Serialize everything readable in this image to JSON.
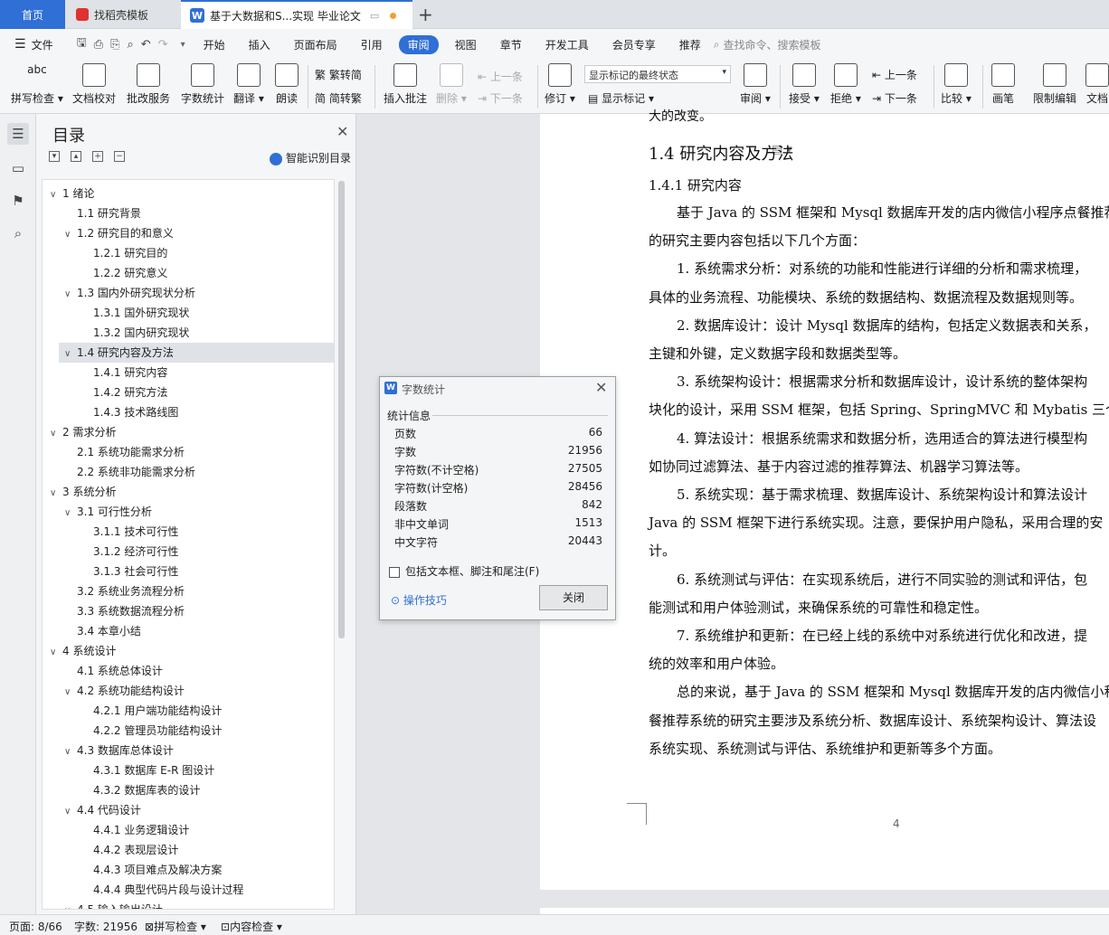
{
  "tabs": {
    "home": "首页",
    "template": "找稻壳模板",
    "document": "基于大数据和S...实现 毕业论文",
    "add": "+"
  },
  "menu": {
    "file": "文件",
    "items": [
      "开始",
      "插入",
      "页面布局",
      "引用",
      "审阅",
      "视图",
      "章节",
      "开发工具",
      "会员专享",
      "推荐"
    ],
    "search": "查找命令、搜索模板"
  },
  "ribbon": {
    "spellcheck": "拼写检查",
    "doc_check": "文档校对",
    "batch_service": "批改服务",
    "word_count": "字数统计",
    "translate": "翻译",
    "read_aloud": "朗读",
    "trad_to_simp": "繁转简",
    "simp_to_trad": "简转繁",
    "insert_comment": "插入批注",
    "delete": "删除",
    "prev": "上一条",
    "next": "下一条",
    "track_changes": "修订",
    "markup_state": "显示标记的最终状态",
    "show_markup": "显示标记",
    "review": "审阅",
    "accept": "接受",
    "reject": "拒绝",
    "prev2": "上一条",
    "next2": "下一条",
    "compare": "比较",
    "pen": "画笔",
    "restrict": "限制编辑",
    "doc_cut": "文档"
  },
  "nav": {
    "title": "目录",
    "smart_toc": "智能识别目录",
    "items": [
      {
        "text": "1  绪论",
        "level": 1,
        "arrow": true
      },
      {
        "text": "1.1 研究背景",
        "level": 2,
        "arrow": false
      },
      {
        "text": "1.2 研究目的和意义",
        "level": 2,
        "arrow": true
      },
      {
        "text": "1.2.1 研究目的",
        "level": 3,
        "arrow": false
      },
      {
        "text": "1.2.2 研究意义",
        "level": 3,
        "arrow": false
      },
      {
        "text": "1.3 国内外研究现状分析",
        "level": 2,
        "arrow": true
      },
      {
        "text": "1.3.1 国外研究现状",
        "level": 3,
        "arrow": false
      },
      {
        "text": "1.3.2 国内研究现状",
        "level": 3,
        "arrow": false
      },
      {
        "text": "1.4 研究内容及方法",
        "level": 2,
        "arrow": true,
        "selected": true
      },
      {
        "text": "1.4.1 研究内容",
        "level": 3,
        "arrow": false
      },
      {
        "text": "1.4.2 研究方法",
        "level": 3,
        "arrow": false
      },
      {
        "text": "1.4.3 技术路线图",
        "level": 3,
        "arrow": false
      },
      {
        "text": "2  需求分析",
        "level": 1,
        "arrow": true
      },
      {
        "text": "2.1 系统功能需求分析",
        "level": 2,
        "arrow": false
      },
      {
        "text": "2.2 系统非功能需求分析",
        "level": 2,
        "arrow": false
      },
      {
        "text": "3  系统分析",
        "level": 1,
        "arrow": true
      },
      {
        "text": "3.1 可行性分析",
        "level": 2,
        "arrow": true
      },
      {
        "text": "3.1.1 技术可行性",
        "level": 3,
        "arrow": false
      },
      {
        "text": "3.1.2 经济可行性",
        "level": 3,
        "arrow": false
      },
      {
        "text": "3.1.3 社会可行性",
        "level": 3,
        "arrow": false
      },
      {
        "text": "3.2 系统业务流程分析",
        "level": 2,
        "arrow": false
      },
      {
        "text": "3.3 系统数据流程分析",
        "level": 2,
        "arrow": false
      },
      {
        "text": "3.4 本章小结",
        "level": 2,
        "arrow": false
      },
      {
        "text": "4  系统设计",
        "level": 1,
        "arrow": true
      },
      {
        "text": "4.1 系统总体设计",
        "level": 2,
        "arrow": false
      },
      {
        "text": "4.2 系统功能结构设计",
        "level": 2,
        "arrow": true
      },
      {
        "text": "4.2.1 用户端功能结构设计",
        "level": 3,
        "arrow": false
      },
      {
        "text": "4.2.2 管理员功能结构设计",
        "level": 3,
        "arrow": false
      },
      {
        "text": "4.3 数据库总体设计",
        "level": 2,
        "arrow": true
      },
      {
        "text": "4.3.1  数据库 E-R 图设计",
        "level": 3,
        "arrow": false
      },
      {
        "text": "4.3.2  数据库表的设计",
        "level": 3,
        "arrow": false
      },
      {
        "text": "4.4 代码设计",
        "level": 2,
        "arrow": true
      },
      {
        "text": "4.4.1 业务逻辑设计",
        "level": 3,
        "arrow": false
      },
      {
        "text": "4.4.2 表现层设计",
        "level": 3,
        "arrow": false
      },
      {
        "text": "4.4.3 项目难点及解决方案",
        "level": 3,
        "arrow": false
      },
      {
        "text": "4.4.4 典型代码片段与设计过程",
        "level": 3,
        "arrow": false
      },
      {
        "text": "4.5 输入输出设计",
        "level": 2,
        "arrow": true
      }
    ]
  },
  "document": {
    "top_fragment": "大的改变。",
    "heading": "1.4 研究内容及方法",
    "subheading": "1.4.1 研究内容",
    "lines": [
      "基于 Java 的 SSM 框架和 Mysql 数据库开发的店内微信小程序点餐推荐",
      "的研究主要内容包括以下几个方面：",
      "1. 系统需求分析：对系统的功能和性能进行详细的分析和需求梳理，",
      "具体的业务流程、功能模块、系统的数据结构、数据流程及数据规则等。",
      "2. 数据库设计：设计 Mysql 数据库的结构，包括定义数据表和关系，",
      "主键和外键，定义数据字段和数据类型等。",
      "3. 系统架构设计：根据需求分析和数据库设计，设计系统的整体架构",
      "块化的设计，采用 SSM 框架，包括 Spring、SpringMVC 和 Mybatis 三个框",
      "4. 算法设计：根据系统需求和数据分析，选用适合的算法进行模型构",
      "如协同过滤算法、基于内容过滤的推荐算法、机器学习算法等。",
      "5. 系统实现：基于需求梳理、数据库设计、系统架构设计和算法设计",
      "Java 的 SSM 框架下进行系统实现。注意，要保护用户隐私，采用合理的安",
      "计。",
      "6. 系统测试与评估：在实现系统后，进行不同实验的测试和评估，包",
      "能测试和用户体验测试，来确保系统的可靠性和稳定性。",
      "7. 系统维护和更新：在已经上线的系统中对系统进行优化和改进，提",
      "统的效率和用户体验。",
      "总的来说，基于 Java 的 SSM 框架和 Mysql 数据库开发的店内微信小程",
      "餐推荐系统的研究主要涉及系统分析、数据库设计、系统架构设计、算法设",
      "系统实现、系统测试与评估、系统维护和更新等多个方面。"
    ],
    "page_number": "4"
  },
  "dialog": {
    "title": "字数统计",
    "section": "统计信息",
    "stats": [
      {
        "label": "页数",
        "value": "66"
      },
      {
        "label": "字数",
        "value": "21956"
      },
      {
        "label": "字符数(不计空格)",
        "value": "27505"
      },
      {
        "label": "字符数(计空格)",
        "value": "28456"
      },
      {
        "label": "段落数",
        "value": "842"
      },
      {
        "label": "非中文单词",
        "value": "1513"
      },
      {
        "label": "中文字符",
        "value": "20443"
      }
    ],
    "checkbox": "包括文本框、脚注和尾注(F)",
    "tips": "操作技巧",
    "close": "关闭"
  },
  "status": {
    "page": "页面: 8/66",
    "words": "字数: 21956",
    "spell": "拼写检查",
    "content": "内容检查"
  },
  "colors": {
    "accent": "#2f6fd6",
    "wps_red": "#e0312f"
  }
}
